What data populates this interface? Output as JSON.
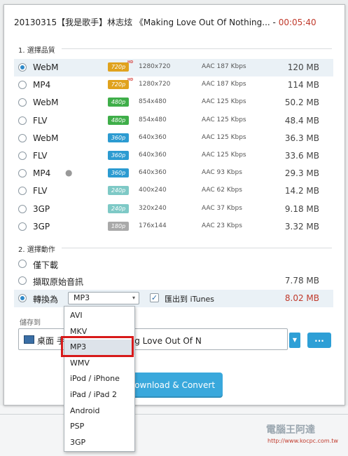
{
  "title": {
    "text": "20130315【我是歌手】林志炫 《Making Love Out Of Nothing...",
    "sep": " - ",
    "time": "00:05:40"
  },
  "section_quality": "1. 選擇品質",
  "section_action": "2. 選擇動作",
  "formats": [
    {
      "name": "WebM",
      "badge": "720p",
      "hd": "HD",
      "resolution": "1280x720",
      "audio": "AAC 187  Kbps",
      "size": "120 MB",
      "selected": true,
      "apple": ""
    },
    {
      "name": "MP4",
      "badge": "720p",
      "hd": "HD",
      "resolution": "1280x720",
      "audio": "AAC 187  Kbps",
      "size": "114 MB",
      "selected": false,
      "apple": ""
    },
    {
      "name": "WebM",
      "badge": "480p",
      "hd": "",
      "resolution": "854x480",
      "audio": "AAC 125  Kbps",
      "size": "50.2 MB",
      "selected": false,
      "apple": ""
    },
    {
      "name": "FLV",
      "badge": "480p",
      "hd": "",
      "resolution": "854x480",
      "audio": "AAC 125  Kbps",
      "size": "48.4 MB",
      "selected": false,
      "apple": ""
    },
    {
      "name": "WebM",
      "badge": "360p",
      "hd": "",
      "resolution": "640x360",
      "audio": "AAC 125  Kbps",
      "size": "36.3 MB",
      "selected": false,
      "apple": ""
    },
    {
      "name": "FLV",
      "badge": "360p",
      "hd": "",
      "resolution": "640x360",
      "audio": "AAC 125  Kbps",
      "size": "33.6 MB",
      "selected": false,
      "apple": ""
    },
    {
      "name": "MP4",
      "badge": "360p",
      "hd": "",
      "resolution": "640x360",
      "audio": "AAC 93  Kbps",
      "size": "29.3 MB",
      "selected": false,
      "apple": "apple-icon"
    },
    {
      "name": "FLV",
      "badge": "240p",
      "hd": "",
      "resolution": "400x240",
      "audio": "AAC 62  Kbps",
      "size": "14.2 MB",
      "selected": false,
      "apple": ""
    },
    {
      "name": "3GP",
      "badge": "240p",
      "hd": "",
      "resolution": "320x240",
      "audio": "AAC 37  Kbps",
      "size": "9.18 MB",
      "selected": false,
      "apple": ""
    },
    {
      "name": "3GP",
      "badge": "180p",
      "hd": "",
      "resolution": "176x144",
      "audio": "AAC 23  Kbps",
      "size": "3.32 MB",
      "selected": false,
      "apple": ""
    }
  ],
  "badge_colors": {
    "720p": "#e0a21d",
    "480p": "#3fae49",
    "360p": "#2c9bd1",
    "240p": "#7ec9c6",
    "180p": "#a9a9a9"
  },
  "actions": {
    "download_only": "僅下載",
    "extract_audio": "擷取原始音訊",
    "extract_audio_size": "7.78 MB",
    "convert_label": "轉換為",
    "convert_selected": "MP3",
    "itunes_label": "匯出到 iTunes",
    "itunes_checked": true,
    "convert_size": "8.02 MB"
  },
  "dropdown_options": [
    "AVI",
    "MKV",
    "MP3",
    "WMV",
    "iPod / iPhone",
    "iPad / iPad 2",
    "Android",
    "PSP",
    "3GP"
  ],
  "save_to": {
    "label": "儲存到",
    "path": "桌面        手】林志炫 《Making Love Out Of N",
    "browse_label": "..."
  },
  "convert_button": "Download & Convert",
  "watermark": {
    "text": "電腦王阿達",
    "url": "http://www.kocpc.com.tw"
  },
  "colors": {
    "accent": "#2e9fd6",
    "highlight": "#d71a1a",
    "time": "#c0392b"
  }
}
